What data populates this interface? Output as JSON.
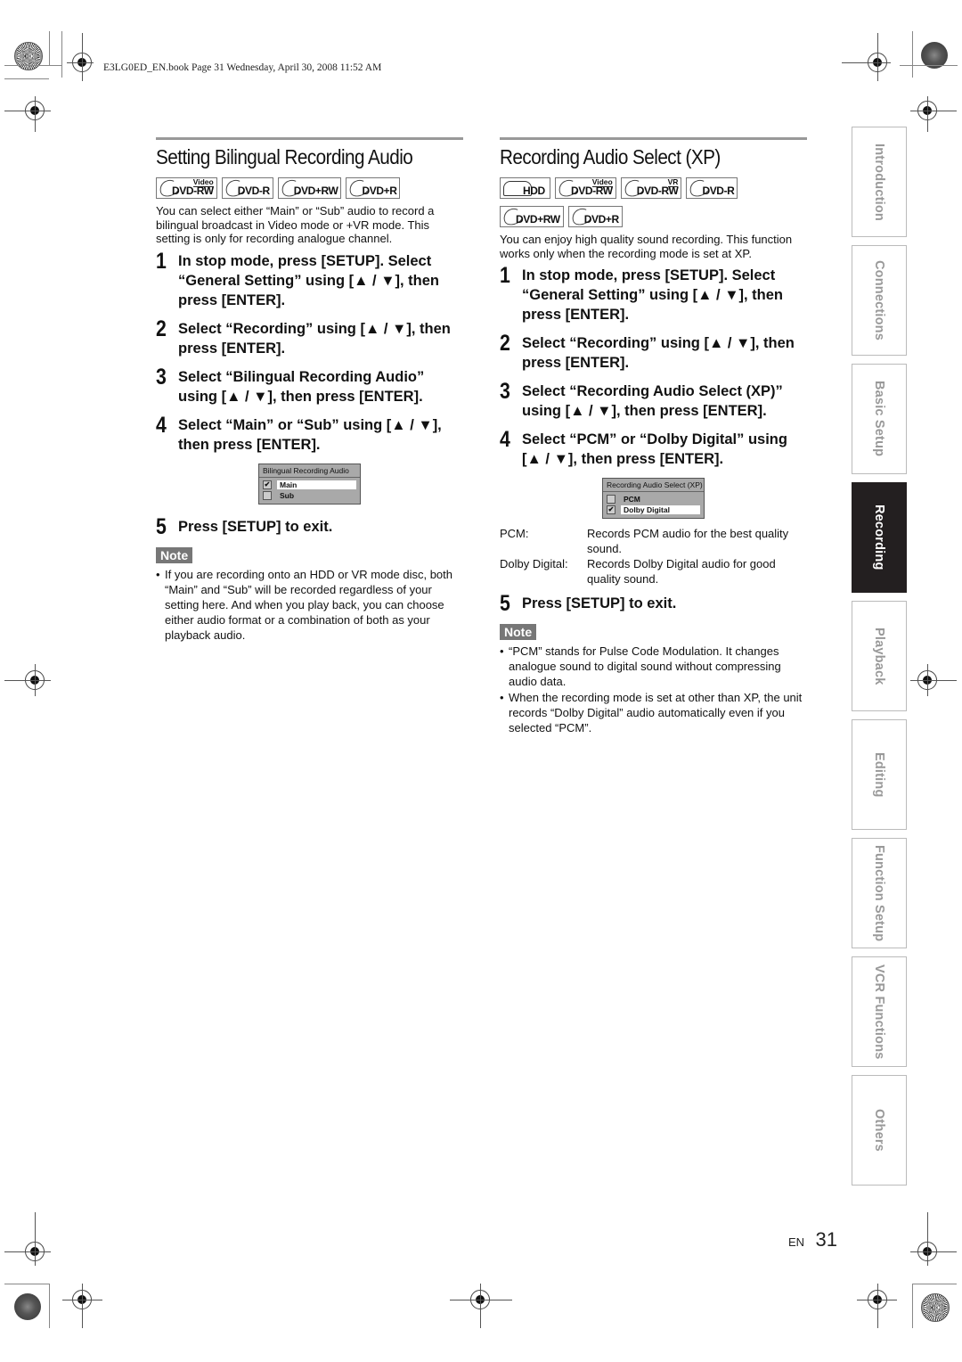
{
  "header": {
    "book_line": "E3LG0ED_EN.book  Page 31  Wednesday, April 30, 2008  11:52 AM"
  },
  "left": {
    "title": "Setting Bilingual Recording Audio",
    "badges": [
      {
        "label": "DVD-RW",
        "sup": "Video"
      },
      {
        "label": "DVD-R",
        "sup": ""
      },
      {
        "label": "DVD+RW",
        "sup": ""
      },
      {
        "label": "DVD+R",
        "sup": ""
      }
    ],
    "intro": "You can select either “Main” or “Sub” audio to record a bilingual broadcast in Video mode or +VR mode. This setting is only for recording analogue channel.",
    "steps": [
      {
        "num": "1",
        "text": "In stop mode, press [SETUP]. Select “General Setting” using [▲ / ▼], then press [ENTER]."
      },
      {
        "num": "2",
        "text": "Select “Recording” using [▲ / ▼], then press [ENTER]."
      },
      {
        "num": "3",
        "text": "Select “Bilingual Recording Audio” using [▲ / ▼], then press [ENTER]."
      },
      {
        "num": "4",
        "text": "Select “Main” or “Sub” using [▲ / ▼], then press [ENTER]."
      },
      {
        "num": "5",
        "text": "Press [SETUP] to exit."
      }
    ],
    "osd": {
      "title": "Bilingual Recording Audio",
      "options": [
        {
          "label": "Main",
          "checked": true,
          "selected": true
        },
        {
          "label": "Sub",
          "checked": false,
          "selected": false
        }
      ]
    },
    "note_label": "Note",
    "notes": [
      "If you are recording onto an HDD or VR mode disc, both “Main” and “Sub” will be recorded regardless of your setting here. And when you play back, you can choose either audio format or a combination of both as your playback audio."
    ]
  },
  "right": {
    "title": "Recording Audio Select (XP)",
    "badges": [
      {
        "label": "HDD",
        "sup": ""
      },
      {
        "label": "DVD-RW",
        "sup": "Video"
      },
      {
        "label": "DVD-RW",
        "sup": "VR"
      },
      {
        "label": "DVD-R",
        "sup": ""
      },
      {
        "label": "DVD+RW",
        "sup": ""
      },
      {
        "label": "DVD+R",
        "sup": ""
      }
    ],
    "intro": "You can enjoy high quality sound recording. This function works only when the recording mode is set at XP.",
    "steps": [
      {
        "num": "1",
        "text": "In stop mode, press [SETUP]. Select “General Setting” using [▲ / ▼], then press [ENTER]."
      },
      {
        "num": "2",
        "text": "Select “Recording” using [▲ / ▼], then press [ENTER]."
      },
      {
        "num": "3",
        "text": "Select “Recording Audio Select (XP)” using [▲ / ▼], then press [ENTER]."
      },
      {
        "num": "4",
        "text": "Select “PCM” or “Dolby Digital” using [▲ / ▼], then press [ENTER]."
      },
      {
        "num": "5",
        "text": "Press [SETUP] to exit."
      }
    ],
    "osd": {
      "title": "Recording Audio Select (XP)",
      "options": [
        {
          "label": "PCM",
          "checked": false,
          "selected": false
        },
        {
          "label": "Dolby Digital",
          "checked": true,
          "selected": true
        }
      ]
    },
    "definitions": [
      {
        "term": "PCM:",
        "desc": "Records PCM audio for the best quality sound."
      },
      {
        "term": "Dolby Digital:",
        "desc": "Records Dolby Digital audio for good quality sound."
      }
    ],
    "note_label": "Note",
    "notes": [
      "“PCM” stands for Pulse Code Modulation. It changes analogue sound to digital sound without compressing audio data.",
      "When the recording mode is set at other than XP, the unit records “Dolby Digital” audio automatically even if you selected “PCM”."
    ]
  },
  "side_tabs": [
    {
      "label": "Introduction",
      "active": false
    },
    {
      "label": "Connections",
      "active": false
    },
    {
      "label": "Basic Setup",
      "active": false
    },
    {
      "label": "Recording",
      "active": true
    },
    {
      "label": "Playback",
      "active": false
    },
    {
      "label": "Editing",
      "active": false
    },
    {
      "label": "Function Setup",
      "active": false
    },
    {
      "label": "VCR Functions",
      "active": false
    },
    {
      "label": "Others",
      "active": false
    }
  ],
  "footer": {
    "lang": "EN",
    "page": "31"
  }
}
